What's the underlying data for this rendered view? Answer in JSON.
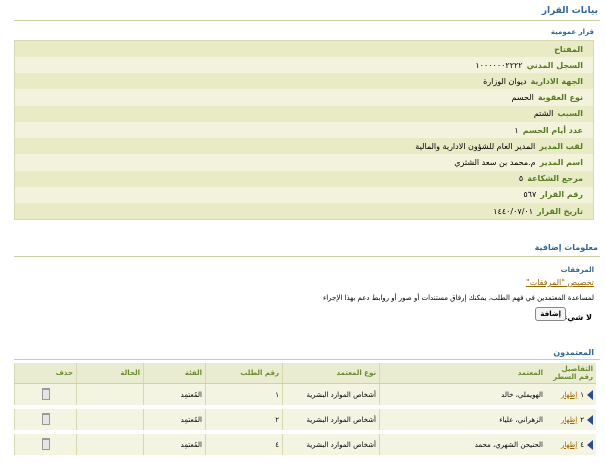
{
  "page": {
    "title": "بيانات القرار",
    "section_title": "قرار عمومية"
  },
  "details": {
    "rows": [
      {
        "label": "المفتاح",
        "value": ""
      },
      {
        "label": "السجل المدني",
        "value": "١٠٠٠٠٠٠٢٢٢٢"
      },
      {
        "label": "الجهة الادارية",
        "value": "ديوان الوزارة"
      },
      {
        "label": "نوع العقوبة",
        "value": "الحسم"
      },
      {
        "label": "السبب",
        "value": "الشتم"
      },
      {
        "label": "عدد أيام الحسم",
        "value": "١"
      },
      {
        "label": "لقب المدير",
        "value": "المدير العام للشؤون الادارية والمالية"
      },
      {
        "label": "اسم المدير",
        "value": "م.محمد بن سعد الشثري"
      },
      {
        "label": "مرجع الشكاعة",
        "value": "٥"
      },
      {
        "label": "رقم القرار",
        "value": "٥٦٧"
      },
      {
        "label": "تاريخ القرار",
        "value": "١٤٤٠/٠٧/٠١"
      }
    ]
  },
  "additional": {
    "title": "معلومات إضافية",
    "attachments_title": "المرفقات",
    "attachments_link": "تخصيص \"المرفقات\"",
    "help_text": "لمساعدة المعتمدين في فهم الطلب، يمكنك إرفاق مستندات أو صور أو روابط دعم بهذا الإجراء",
    "none_label": "لا شيء",
    "add_button": "إضافة"
  },
  "approvers": {
    "title": "المعتمدون",
    "columns": {
      "details": "التفاصيل",
      "line_no": "رقم السطر",
      "approver": "المعتمد",
      "approver_type": "نوع المعتمد",
      "request_no": "رقم الطلب",
      "category": "الفئة",
      "status": "الحالة",
      "delete": "حذف"
    },
    "rows": [
      {
        "show": "إظهار",
        "line_no": "١",
        "approver": "الهويملي، خالد",
        "approver_type": "أشخاص الموارد البشرية",
        "request_no": "١",
        "category": "المُعتمِد",
        "status": ""
      },
      {
        "show": "إظهار",
        "line_no": "٢",
        "approver": "الزهراني، علياء",
        "approver_type": "أشخاص الموارد البشرية",
        "request_no": "٢",
        "category": "المُعتمِد",
        "status": ""
      },
      {
        "show": "إظهار",
        "line_no": "٤",
        "approver": "الحنيحن الشهري، محمد",
        "approver_type": "أشخاص الموارد البشرية",
        "request_no": "٤",
        "category": "المُعتمِد",
        "status": ""
      }
    ]
  }
}
